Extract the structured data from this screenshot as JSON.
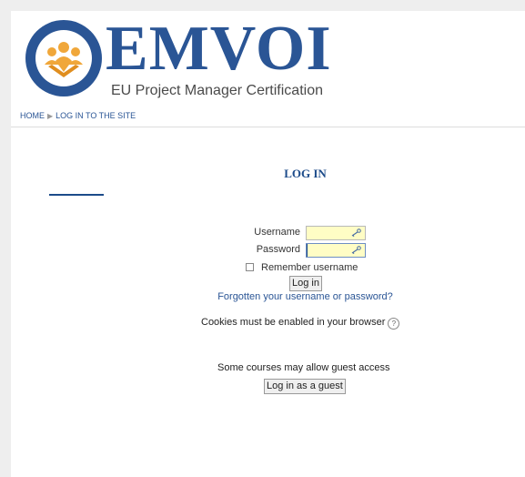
{
  "brand": {
    "name": "EMVOI",
    "tagline": "EU Project Manager Certification",
    "colors": {
      "primary": "#2a5595",
      "accent": "#f0a73a"
    }
  },
  "breadcrumb": {
    "home": "HOME",
    "current": "LOG IN TO THE SITE"
  },
  "login": {
    "title": "LOG IN",
    "username_label": "Username",
    "password_label": "Password",
    "username_value": "",
    "password_value": "",
    "remember_label": "Remember username",
    "remember_checked": false,
    "submit_label": "Log in",
    "forgot_link": "Forgotten your username or password?",
    "cookies_note": "Cookies must be enabled in your browser",
    "help_icon": "?",
    "guest_note": "Some courses may allow guest access",
    "guest_button": "Log in as a guest"
  }
}
